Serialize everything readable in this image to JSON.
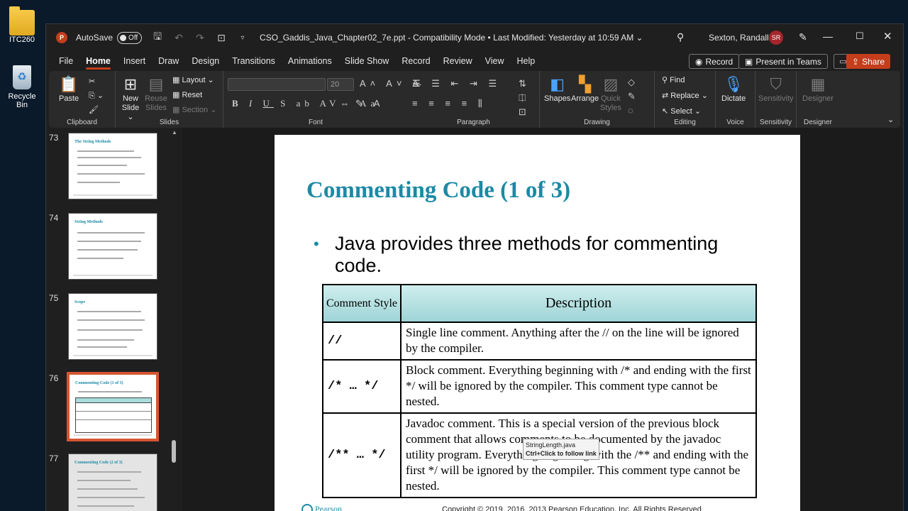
{
  "desktop": {
    "icons": [
      {
        "label": "ITC260"
      },
      {
        "label": "Recycle Bin"
      }
    ]
  },
  "titlebar": {
    "autosave_label": "AutoSave",
    "autosave_state": "Off",
    "doc_title": "CSO_Gaddis_Java_Chapter02_7e.ppt  -  Compatibility Mode  •  Last Modified: Yesterday at 10:59 AM ⌄",
    "user_name": "Sexton, Randall S",
    "user_initials": "SR"
  },
  "menu": {
    "tabs": [
      "File",
      "Home",
      "Insert",
      "Draw",
      "Design",
      "Transitions",
      "Animations",
      "Slide Show",
      "Record",
      "Review",
      "View",
      "Help"
    ],
    "record_btn": "Record",
    "present_btn": "Present in Teams",
    "share_btn": "Share"
  },
  "ribbon": {
    "groups": {
      "clipboard": "Clipboard",
      "slides": "Slides",
      "font": "Font",
      "paragraph": "Paragraph",
      "drawing": "Drawing",
      "editing": "Editing",
      "voice": "Voice",
      "sensitivity": "Sensitivity",
      "designer": "Designer"
    },
    "paste": "Paste",
    "new_slide": "New Slide ⌄",
    "reuse_slides": "Reuse Slides",
    "layout": "Layout ⌄",
    "reset": "Reset",
    "section": "Section ⌄",
    "font_size": "20",
    "shapes": "Shapes",
    "arrange": "Arrange",
    "quick_styles": "Quick Styles",
    "find": "Find",
    "replace": "Replace",
    "select": "Select",
    "dictate": "Dictate",
    "sensitivity_btn": "Sensitivity",
    "designer_btn": "Designer"
  },
  "thumbnails": [
    {
      "num": "73",
      "title": "The String Methods"
    },
    {
      "num": "74",
      "title": "String Methods"
    },
    {
      "num": "75",
      "title": "Scope"
    },
    {
      "num": "76",
      "title": "Commenting Code (1 of 3)"
    },
    {
      "num": "77",
      "title": "Commenting Code (2 of 3)"
    }
  ],
  "slide": {
    "title": "Commenting Code (1 of 3)",
    "bullet": "Java provides three methods for commenting code.",
    "table": {
      "headers": [
        "Comment Style",
        "Description"
      ],
      "rows": [
        {
          "style": "//",
          "desc": "Single line comment.  Anything after the // on the line will be ignored by the compiler."
        },
        {
          "style": "/* … */",
          "desc": "Block comment.  Everything beginning with /* and ending with the first */ will be ignored by the compiler.  This comment type cannot be nested."
        },
        {
          "style": "/** … */",
          "desc": "Javadoc comment.  This is a special version of the previous block comment that allows comments to be documented by the javadoc utility program.  Everything beginning with the /** and ending with the first */ will be ignored by the compiler.  This comment type cannot be nested."
        }
      ]
    },
    "tooltip": {
      "file": "StringLength.java",
      "hint": "Ctrl+Click to follow link"
    },
    "footer": "Copyright © 2019, 2016, 2013 Pearson Education, Inc. All Rights Reserved",
    "logo": "Pearson"
  }
}
